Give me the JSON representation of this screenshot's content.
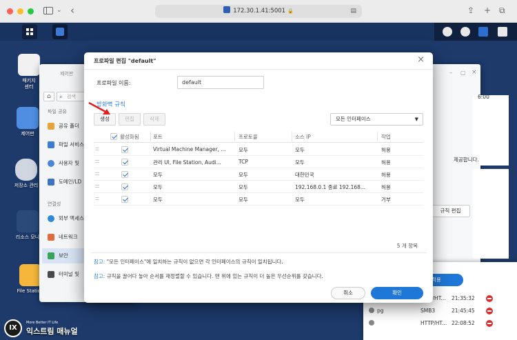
{
  "browser": {
    "url": "172.30.1.41:5001"
  },
  "desktop": {
    "icons": [
      {
        "label": "패키지\n센터"
      },
      {
        "label": "제어판"
      },
      {
        "label": "저장소 관리"
      },
      {
        "label": "리소스 모니"
      },
      {
        "label": "File Station"
      }
    ]
  },
  "control_panel": {
    "title": "제어판",
    "search_placeholder": "검색",
    "section_file_sharing": "파일 공유",
    "section_connectivity": "연결성",
    "items": [
      {
        "label": "공유 폴더"
      },
      {
        "label": "파일 서비스"
      },
      {
        "label": "사용자 및"
      },
      {
        "label": "도메인/LD"
      },
      {
        "label": "외부 액세스"
      },
      {
        "label": "네트워크"
      },
      {
        "label": "보안"
      },
      {
        "label": "터미널 및"
      }
    ]
  },
  "right_window": {
    "time_fragment": "6:00",
    "text_fragment": "제공합니다.",
    "rule_edit_label": "규칙 편집",
    "apply_label": "적용"
  },
  "log": {
    "rows": [
      {
        "user": "",
        "protocol": "P/HT...",
        "time": "21:35:32"
      },
      {
        "user": "pg",
        "protocol": "SMB3",
        "time": "21:45:45"
      },
      {
        "user": "",
        "protocol": "HTTP/HT...",
        "time": "22:08:52"
      }
    ]
  },
  "dialog": {
    "title": "프로파일 편집 \"default\"",
    "profile_name_label": "프로파일 이름:",
    "profile_name_value": "default",
    "section_title": "방화벽 규칙",
    "toolbar": {
      "create": "생성",
      "edit": "편집",
      "delete": "삭제"
    },
    "interface_select": "모든 인터페이스",
    "columns": {
      "enabled": "활성화됨",
      "port": "포트",
      "protocol": "프로토콜",
      "source_ip": "소스 IP",
      "action": "작업"
    },
    "rules": [
      {
        "enabled": true,
        "port": "Virtual Machine Manager, ...",
        "protocol": "모두",
        "source_ip": "모두",
        "action": "허용"
      },
      {
        "enabled": true,
        "port": "관리 UI, File Station, Audi...",
        "protocol": "TCP",
        "source_ip": "모두",
        "action": "허용"
      },
      {
        "enabled": true,
        "port": "모두",
        "protocol": "모두",
        "source_ip": "대한민국",
        "action": "허용"
      },
      {
        "enabled": true,
        "port": "모두",
        "protocol": "모두",
        "source_ip": "192.168.0.1 종료 192.168...",
        "action": "허용"
      },
      {
        "enabled": true,
        "port": "모두",
        "protocol": "모두",
        "source_ip": "모두",
        "action": "거부"
      }
    ],
    "item_count": "5 개 항목",
    "note1_key": "참고:",
    "note1_text": "\"모든 인터페이스\"에 일치하는 규칙이 없으면 각 인터페이스의 규칙이 일치됩니다.",
    "note2_key": "참고:",
    "note2_text": "규칙을 끌어다 놓아 순서를 재정렬할 수 있습니다. 맨 위에 있는 규칙이 더 높은 우선순위를 갖습니다.",
    "cancel": "취소",
    "ok": "확인"
  },
  "watermark": {
    "badge": "IX",
    "tagline": "More Better IT Life",
    "name": "익스트림 매뉴얼"
  },
  "colors": {
    "accent": "#1f77d8",
    "link": "#2d7fe0",
    "danger": "#d62f2f"
  }
}
